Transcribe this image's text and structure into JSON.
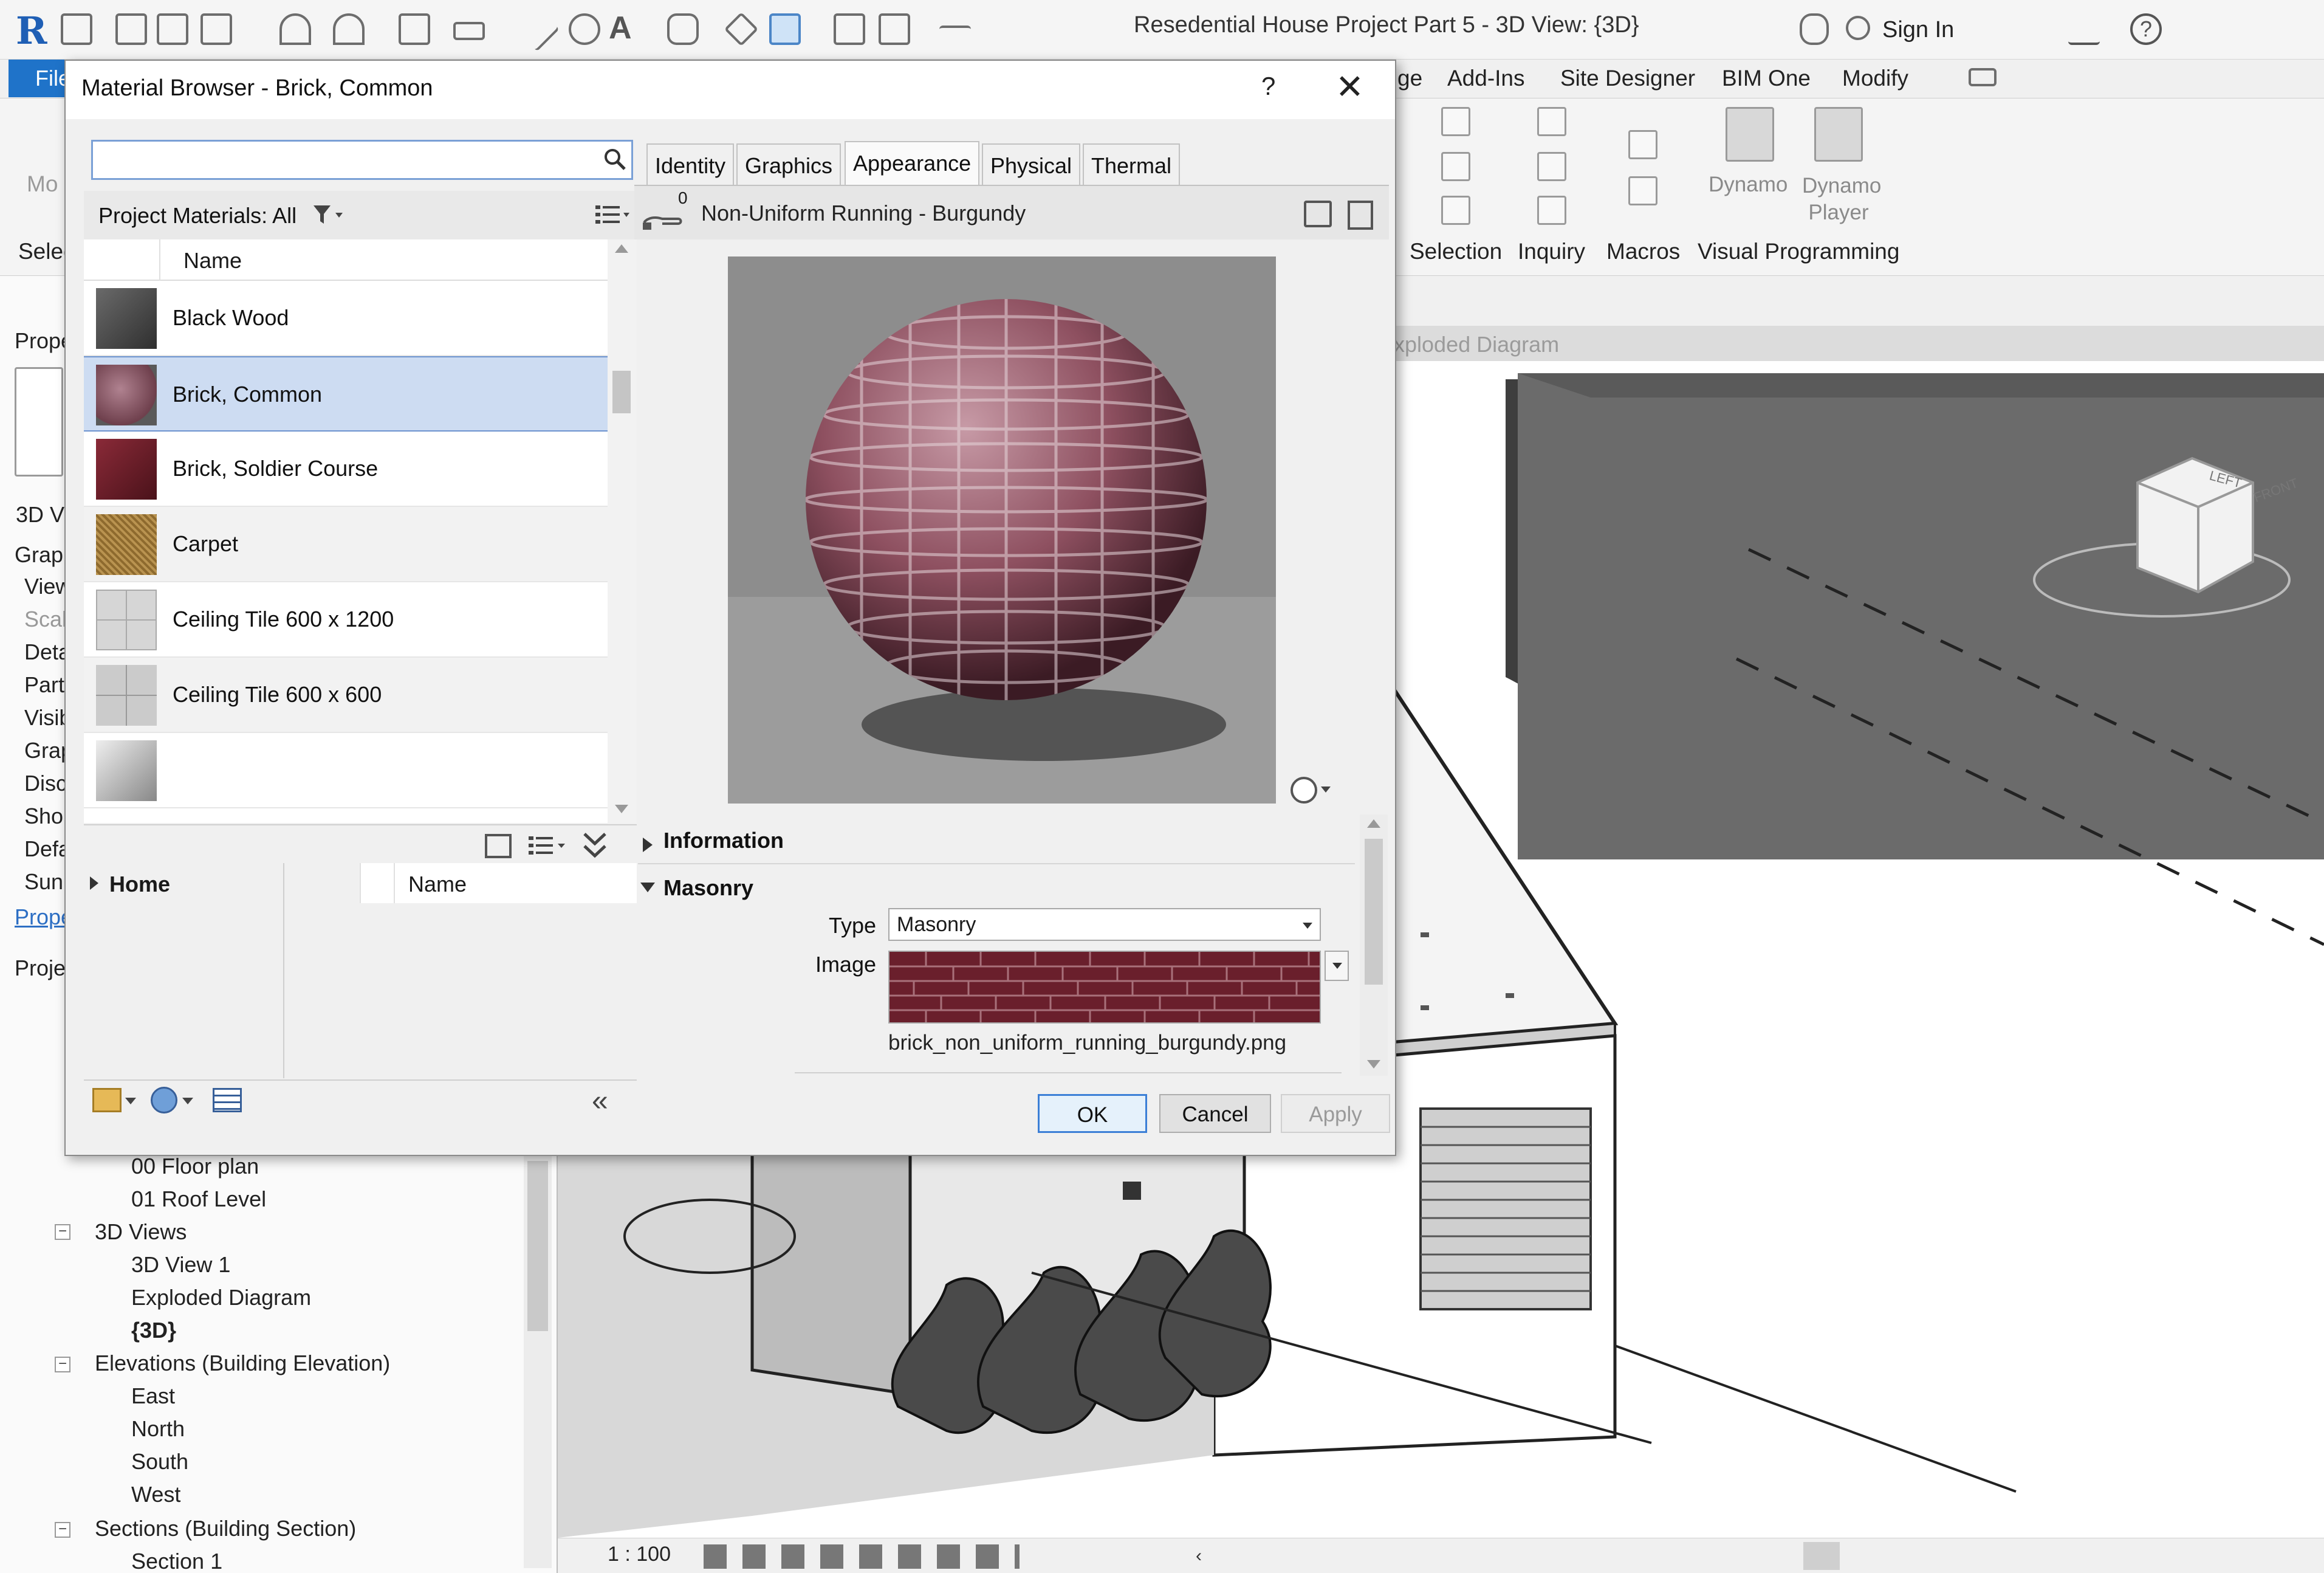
{
  "titlebar": {
    "app_logo": "R",
    "window_title": "Resedential House Project Part 5 - 3D View: {3D}",
    "sign_in": "Sign In",
    "help_icon": "?"
  },
  "ribbon": {
    "file_label": "File",
    "tabs": [
      "Add-Ins",
      "Site Designer",
      "BIM One",
      "Modify"
    ],
    "partial_tab": "ge",
    "panels": [
      "Selection",
      "Inquiry",
      "Macros",
      "Visual Programming"
    ],
    "dynamo_label": "Dynamo",
    "dynamo_player_label": "Dynamo Player",
    "left_partial": [
      "Mo",
      "Selec"
    ]
  },
  "properties": {
    "header_partial": "Prope",
    "view_type_partial": "3D V",
    "rows": [
      "Graph",
      "View",
      "Scal",
      "Deta",
      "Part",
      "Visib",
      "Grap",
      "Disc",
      "Sho",
      "Defa",
      "Sun"
    ],
    "link_partial": "Prope",
    "browser_partial": "Proje"
  },
  "project_browser": {
    "items": [
      {
        "label": "00 Floor plan",
        "bold": false
      },
      {
        "label": "01 Roof Level",
        "bold": false
      },
      {
        "label": "3D Views",
        "bold": false
      },
      {
        "label": "3D View 1",
        "bold": false
      },
      {
        "label": "Exploded Diagram",
        "bold": false
      },
      {
        "label": "{3D}",
        "bold": true
      },
      {
        "label": "Elevations (Building Elevation)",
        "bold": false
      },
      {
        "label": "East",
        "bold": false
      },
      {
        "label": "North",
        "bold": false
      },
      {
        "label": "South",
        "bold": false
      },
      {
        "label": "West",
        "bold": false
      },
      {
        "label": "Sections (Building Section)",
        "bold": false
      },
      {
        "label": "Section 1",
        "bold": false
      }
    ]
  },
  "view": {
    "header_partial": "xploded Diagram",
    "scale": "1 : 100",
    "viewcube_left": "LEFT",
    "viewcube_front": "FRONT"
  },
  "dialog": {
    "title": "Material Browser - Brick, Common",
    "help": "?",
    "close": "✕",
    "search": {
      "value": "",
      "placeholder": ""
    },
    "filter_label": "Project Materials: All",
    "list_header": "Name",
    "materials": [
      {
        "name": "Black Wood",
        "thumb": "#4a4a4a",
        "selected": false
      },
      {
        "name": "Brick, Common",
        "thumb": "#8a5a66",
        "selected": true
      },
      {
        "name": "Brick, Soldier Course",
        "thumb": "#6e1f2a",
        "selected": false
      },
      {
        "name": "Carpet",
        "thumb": "#b08a4a",
        "selected": false
      },
      {
        "name": "Ceiling Tile 600 x 1200",
        "thumb": "#c8c8c8",
        "selected": false
      },
      {
        "name": "Ceiling Tile 600 x 600",
        "thumb": "#bdbdbd",
        "selected": false
      }
    ],
    "library": {
      "home_label": "Home",
      "name_header": "Name"
    },
    "tabs": [
      "Identity",
      "Graphics",
      "Appearance",
      "Physical",
      "Thermal"
    ],
    "active_tab": "Appearance",
    "asset": {
      "count": "0",
      "name": "Non-Uniform Running - Burgundy"
    },
    "sections": {
      "information": "Information",
      "masonry": "Masonry"
    },
    "masonry": {
      "type_label": "Type",
      "type_value": "Masonry",
      "image_label": "Image",
      "image_file": "brick_non_uniform_running_burgundy.png"
    },
    "buttons": {
      "ok": "OK",
      "cancel": "Cancel",
      "apply": "Apply"
    }
  },
  "colors": {
    "accent": "#1f73c9",
    "selection": "#cddcf2",
    "brick": "#8a4a58"
  }
}
